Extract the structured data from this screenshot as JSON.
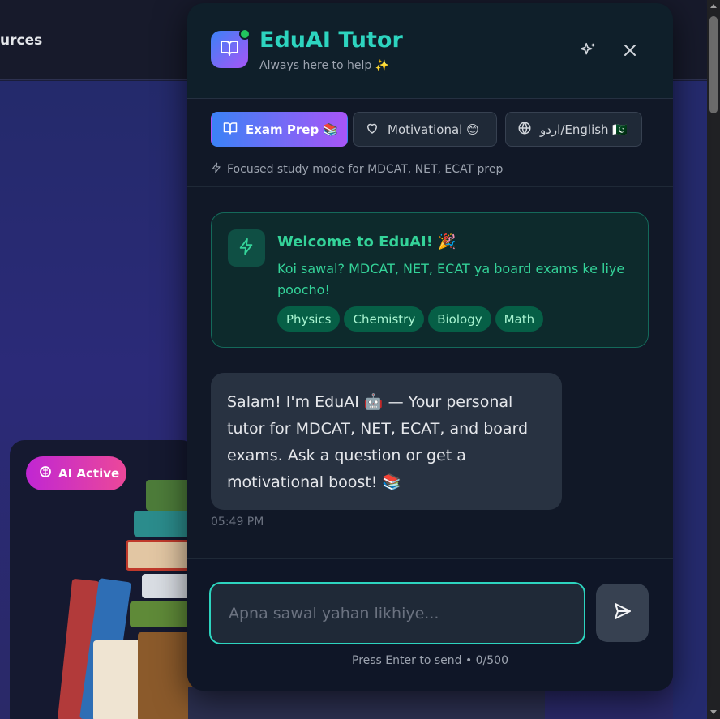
{
  "background": {
    "nav_text": "urces",
    "ai_badge": "AI Active"
  },
  "chat": {
    "title": "EduAI Tutor",
    "subtitle": "Always here to help ✨",
    "modes": [
      {
        "label": "Exam Prep 📚",
        "icon": "book-icon",
        "active": true
      },
      {
        "label": "Motivational 😊",
        "icon": "heart-icon",
        "active": false
      },
      {
        "label": "اردو/English 🇵🇰",
        "icon": "globe-icon",
        "active": false
      }
    ],
    "mode_description": "Focused study mode for MDCAT, NET, ECAT prep",
    "welcome": {
      "title": "Welcome to EduAI! 🎉",
      "text": "Koi sawal? MDCAT, NET, ECAT ya board exams ke liye poocho!",
      "subjects": [
        "Physics",
        "Chemistry",
        "Biology",
        "Math"
      ]
    },
    "message": {
      "text": "Salam! I'm EduAI 🤖 — Your personal tutor for MDCAT, NET, ECAT, and board exams. Ask a question or get a motivational boost! 📚",
      "time": "05:49 PM"
    },
    "input": {
      "placeholder": "Apna sawal yahan likhiye...",
      "value": ""
    },
    "hint": "Press Enter to send • 0/500"
  },
  "colors": {
    "accent": "#2dd4bf",
    "welcome_text": "#34d399",
    "online": "#22c55e"
  }
}
